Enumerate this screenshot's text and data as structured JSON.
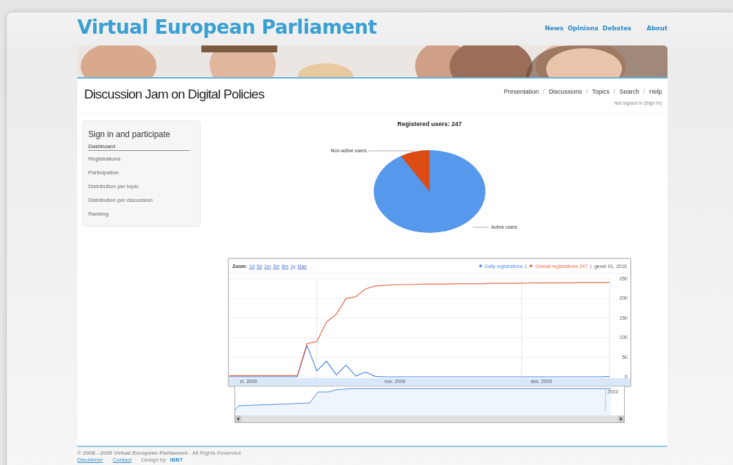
{
  "header": {
    "site_title": "Virtual European Parliament",
    "nav": [
      "News",
      "Opinions",
      "Debates",
      "About"
    ]
  },
  "subheader": {
    "title": "Discussion Jam on Digital Policies",
    "nav": [
      {
        "label": "Presentation",
        "separator": "/"
      },
      {
        "label": "Discussions",
        "separator": "/"
      },
      {
        "label": "Topics",
        "separator": "/"
      },
      {
        "label": "Search",
        "separator": "/"
      },
      {
        "label": "Help"
      }
    ],
    "signin_status": "Not signed in (Sign In)"
  },
  "sidebar": {
    "title": "Sign in and participate",
    "items": [
      {
        "label": "Dashboard",
        "selected": true
      },
      {
        "label": "Registrations",
        "selected": false
      },
      {
        "label": "Participation",
        "selected": false
      },
      {
        "label": "Distribution per topic",
        "selected": false
      },
      {
        "label": "Distribution per discussion",
        "selected": false
      },
      {
        "label": "Ranking",
        "selected": false
      }
    ]
  },
  "pie": {
    "title": "Registered users: 247",
    "labels": [
      "Non-active users",
      "Active users"
    ]
  },
  "timeline": {
    "zoom_label": "Zoom:",
    "zoom_options": [
      "1d",
      "5d",
      "1m",
      "3m",
      "6m",
      "1y",
      "Max"
    ],
    "legend": [
      {
        "value": "1"
      },
      {
        "value": "247"
      }
    ],
    "date_separator": "|",
    "date": "gener 01, 2010",
    "navigator_label": "2010",
    "chart_data": {
      "type": "line",
      "grid": true,
      "categories": [
        null,
        null,
        "ct. 2009",
        null,
        null,
        null,
        null,
        null,
        null,
        null,
        null,
        null,
        null,
        null,
        null,
        null,
        null,
        "nov. 2009",
        null,
        null,
        null,
        null,
        null,
        null,
        null,
        null,
        null,
        null,
        null,
        null,
        null,
        null,
        "des. 2009",
        null,
        null,
        null,
        null,
        null,
        null,
        null
      ],
      "ylim": [
        0,
        250
      ],
      "yticks": [
        0,
        50,
        100,
        150,
        200,
        250
      ],
      "series": [
        {
          "name": "Daily registrations",
          "color": "#4a86e8",
          "values": [
            0,
            0,
            0,
            0,
            0,
            0,
            0,
            0,
            80,
            15,
            40,
            5,
            30,
            2,
            12,
            1,
            0,
            0,
            0,
            0,
            0,
            0,
            0,
            0,
            0,
            0,
            0,
            0,
            0,
            0,
            0,
            0,
            0,
            0,
            0,
            0,
            0,
            0,
            0,
            1
          ]
        },
        {
          "name": "Overall registrations",
          "color": "#e8674a",
          "values": [
            3,
            3,
            3,
            3,
            3,
            3,
            3,
            3,
            85,
            90,
            140,
            160,
            200,
            205,
            225,
            232,
            234,
            235,
            236,
            236,
            237,
            237,
            237,
            238,
            238,
            238,
            238,
            239,
            239,
            239,
            239,
            240,
            240,
            240,
            240,
            240,
            241,
            241,
            241,
            241
          ]
        }
      ]
    }
  },
  "footer": {
    "copyright": "**© 2008 - 2009 Virtual European Parliament** - All Rights Reserved",
    "links": [
      "Disclaimer",
      "Contact"
    ],
    "credit": "Design by",
    "credit_link": "IBBT"
  }
}
